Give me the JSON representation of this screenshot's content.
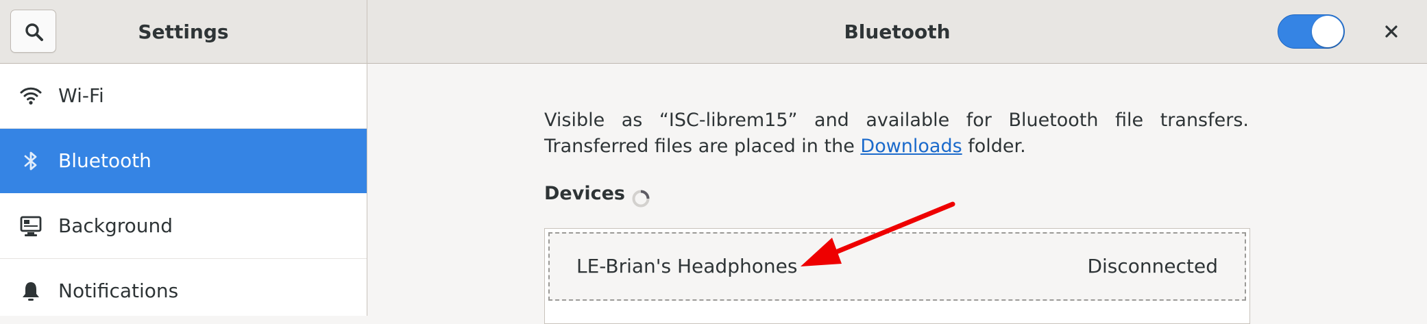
{
  "header": {
    "settings_title": "Settings",
    "main_title": "Bluetooth",
    "bluetooth_switch_on": true,
    "accent_color": "#3584e4"
  },
  "sidebar": {
    "items": [
      {
        "label": "Wi-Fi",
        "icon": "wifi-icon",
        "selected": false
      },
      {
        "label": "Bluetooth",
        "icon": "bluetooth-icon",
        "selected": true
      },
      {
        "label": "Background",
        "icon": "background-icon",
        "selected": false
      },
      {
        "label": "Notifications",
        "icon": "bell-icon",
        "selected": false
      }
    ]
  },
  "main": {
    "desc_before": "Visible as “ISC-librem15” and available for Bluetooth file transfers. Transferred files are placed in the ",
    "desc_link": "Downloads",
    "desc_after": " folder.",
    "devices_heading": "Devices",
    "devices": [
      {
        "name": "LE-Brian's Headphones",
        "status": "Disconnected"
      }
    ]
  },
  "annotation": {
    "arrow_color": "#ee0000"
  }
}
